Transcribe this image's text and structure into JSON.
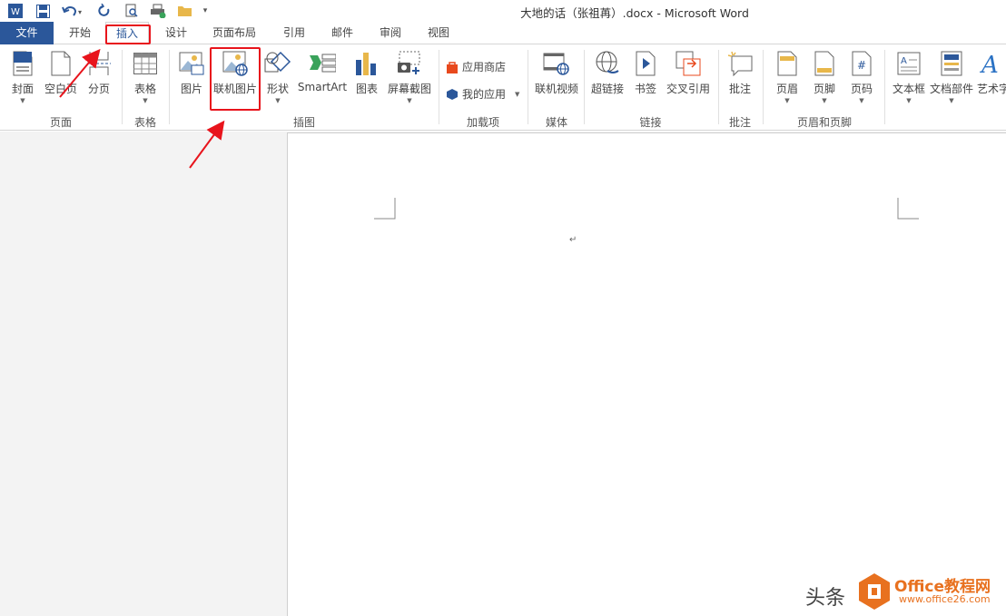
{
  "window": {
    "title": "大地的话（张祖苒）.docx - Microsoft Word"
  },
  "quick_access": {
    "icons": [
      "word-app-icon",
      "save-icon",
      "undo-icon",
      "redo-icon",
      "print-preview-icon",
      "print-icon",
      "open-folder-icon",
      "customize-icon"
    ]
  },
  "tabs": [
    {
      "label": "文件"
    },
    {
      "label": "开始"
    },
    {
      "label": "插入"
    },
    {
      "label": "设计"
    },
    {
      "label": "页面布局"
    },
    {
      "label": "引用"
    },
    {
      "label": "邮件"
    },
    {
      "label": "审阅"
    },
    {
      "label": "视图"
    }
  ],
  "active_tab": "插入",
  "ribbon": {
    "groups": [
      {
        "label": "页面",
        "buttons": [
          "封面",
          "空白页",
          "分页"
        ]
      },
      {
        "label": "表格",
        "buttons": [
          "表格"
        ]
      },
      {
        "label": "插图",
        "buttons": [
          "图片",
          "联机图片",
          "形状",
          "SmartArt",
          "图表",
          "屏幕截图"
        ]
      },
      {
        "label": "加载项",
        "buttons": [
          "应用商店",
          "我的应用"
        ]
      },
      {
        "label": "媒体",
        "buttons": [
          "联机视频"
        ]
      },
      {
        "label": "链接",
        "buttons": [
          "超链接",
          "书签",
          "交叉引用"
        ]
      },
      {
        "label": "批注",
        "buttons": [
          "批注"
        ]
      },
      {
        "label": "页眉和页脚",
        "buttons": [
          "页眉",
          "页脚",
          "页码"
        ]
      },
      {
        "label": "",
        "buttons": [
          "文本框",
          "文档部件",
          "艺术字"
        ]
      }
    ]
  },
  "document": {
    "paragraph_mark": "↵"
  },
  "annotations": {
    "highlighted": [
      "插入",
      "联机图片"
    ],
    "color": "#e8141c"
  },
  "watermark": {
    "prefix": "头条",
    "brand": "Office教程网",
    "url": "www.office26.com"
  },
  "colors": {
    "file_tab": "#2b579a",
    "accent": "#2b579a",
    "annotation": "#e8141c",
    "brand": "#e8711f"
  }
}
